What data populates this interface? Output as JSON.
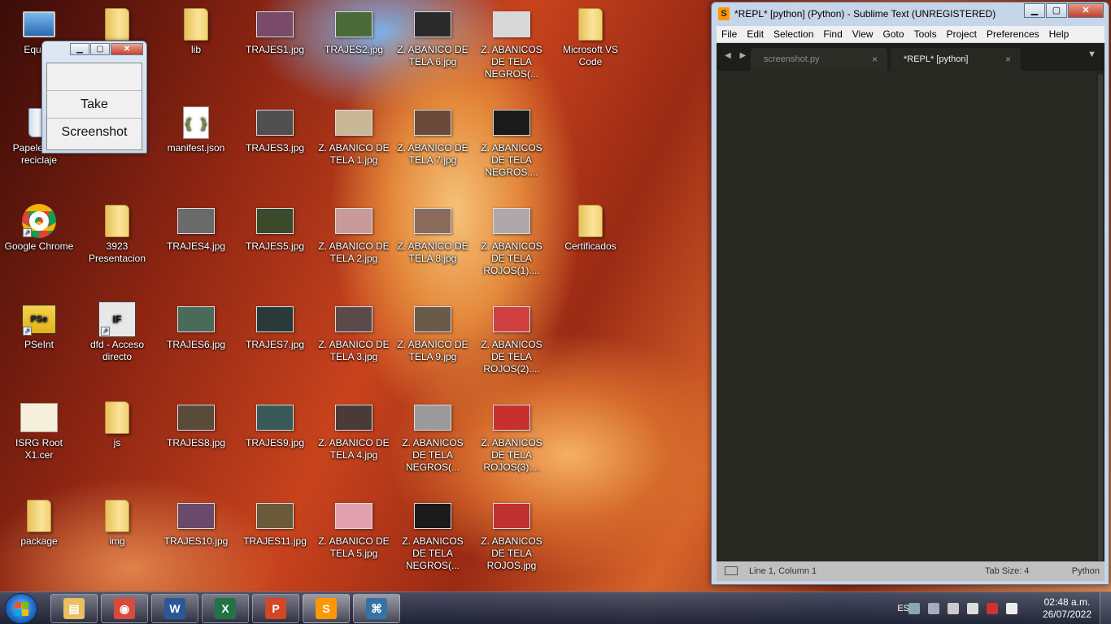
{
  "desktop_icons": [
    {
      "label": "Equipo",
      "kind": "computer"
    },
    {
      "label": "",
      "kind": "folder"
    },
    {
      "label": "lib",
      "kind": "folder"
    },
    {
      "label": "TRAJES1.jpg",
      "kind": "thumb",
      "color": "#7a4a6a"
    },
    {
      "label": "TRAJES2.jpg",
      "kind": "thumb",
      "color": "#4a6a3a"
    },
    {
      "label": "Z. ABANICO DE TELA 6.jpg",
      "kind": "thumb",
      "color": "#2a2a2a"
    },
    {
      "label": "Z. ABANICOS DE TELA NEGROS(...",
      "kind": "thumb",
      "color": "#d8d8d8"
    },
    {
      "label": "Microsoft VS Code",
      "kind": "folder"
    },
    {
      "label": "Papelera de reciclaje",
      "kind": "recycle"
    },
    {
      "label": "manifest.json",
      "kind": "json"
    },
    {
      "label": "TRAJES3.jpg",
      "kind": "thumb",
      "color": "#505050"
    },
    {
      "label": "Z. ABANICO DE TELA 1.jpg",
      "kind": "thumb",
      "color": "#c8b898"
    },
    {
      "label": "Z. ABANICO DE TELA 7.jpg",
      "kind": "thumb",
      "color": "#6a4a3a"
    },
    {
      "label": "Z. ABANICOS DE TELA NEGROS....",
      "kind": "thumb",
      "color": "#1a1a1a"
    },
    {
      "label": "Google Chrome",
      "kind": "chrome"
    },
    {
      "label": "3923 Presentacion",
      "kind": "folder"
    },
    {
      "label": "TRAJES4.jpg",
      "kind": "thumb",
      "color": "#6a6a6a"
    },
    {
      "label": "TRAJES5.jpg",
      "kind": "thumb",
      "color": "#3a4a2a"
    },
    {
      "label": "Z. ABANICO DE TELA 2.jpg",
      "kind": "thumb",
      "color": "#c89a9a"
    },
    {
      "label": "Z. ABANICO DE TELA 8.jpg",
      "kind": "thumb",
      "color": "#8a6a5a"
    },
    {
      "label": "Z. ABANICOS DE TELA ROJOS(1)....",
      "kind": "thumb",
      "color": "#b0a8a8"
    },
    {
      "label": "Certificados",
      "kind": "folder"
    },
    {
      "label": "PSeInt",
      "kind": "pseint"
    },
    {
      "label": "dfd - Acceso directo",
      "kind": "dfd"
    },
    {
      "label": "TRAJES6.jpg",
      "kind": "thumb",
      "color": "#4a6a5a"
    },
    {
      "label": "TRAJES7.jpg",
      "kind": "thumb",
      "color": "#2a3a3a"
    },
    {
      "label": "Z. ABANICO DE TELA 3.jpg",
      "kind": "thumb",
      "color": "#5a4a4a"
    },
    {
      "label": "Z. ABANICO DE TELA 9.jpg",
      "kind": "thumb",
      "color": "#6a5a4a"
    },
    {
      "label": "Z. ABANICOS DE TELA ROJOS(2)....",
      "kind": "thumb",
      "color": "#d04040"
    },
    {
      "label": "ISRG Root X1.cer",
      "kind": "cert"
    },
    {
      "label": "js",
      "kind": "folder"
    },
    {
      "label": "TRAJES8.jpg",
      "kind": "thumb",
      "color": "#5a4a3a"
    },
    {
      "label": "TRAJES9.jpg",
      "kind": "thumb",
      "color": "#3a5a5a"
    },
    {
      "label": "Z. ABANICO DE TELA 4.jpg",
      "kind": "thumb",
      "color": "#4a3a3a"
    },
    {
      "label": "Z. ABANICOS DE TELA NEGROS(...",
      "kind": "thumb",
      "color": "#9a9a9a"
    },
    {
      "label": "Z. ABANICOS DE TELA ROJOS(3)....",
      "kind": "thumb",
      "color": "#c83030"
    },
    {
      "label": "package",
      "kind": "folder"
    },
    {
      "label": "img",
      "kind": "folder"
    },
    {
      "label": "TRAJES10.jpg",
      "kind": "thumb",
      "color": "#6a4a6a"
    },
    {
      "label": "TRAJES11.jpg",
      "kind": "thumb",
      "color": "#6a5a3a"
    },
    {
      "label": "Z. ABANICO DE TELA 5.jpg",
      "kind": "thumb",
      "color": "#e0a0b0"
    },
    {
      "label": "Z. ABANICOS DE TELA NEGROS(...",
      "kind": "thumb",
      "color": "#1a1a1a"
    },
    {
      "label": "Z. ABANICOS DE TELA ROJOS.jpg",
      "kind": "thumb",
      "color": "#c03030"
    }
  ],
  "tk_window": {
    "button_label": "Take Screenshot",
    "minimize": "▁",
    "maximize": "▢",
    "close": "✕"
  },
  "sublime": {
    "title": "*REPL* [python] (Python) - Sublime Text (UNREGISTERED)",
    "logo_letter": "S",
    "minimize": "▁",
    "maximize": "▢",
    "close": "✕",
    "menu": [
      "File",
      "Edit",
      "Selection",
      "Find",
      "View",
      "Goto",
      "Tools",
      "Project",
      "Preferences",
      "Help"
    ],
    "tab_arrows": "◀ ▶",
    "tabs": [
      {
        "label": "screenshot.py",
        "active": false,
        "close": "×"
      },
      {
        "label": "*REPL* [python]",
        "active": true,
        "close": "×"
      }
    ],
    "tab_menu": "▼",
    "status": {
      "position": "Line 1, Column 1",
      "tab_size": "Tab Size: 4",
      "syntax": "Python"
    }
  },
  "taskbar": {
    "pinned": [
      {
        "name": "explorer",
        "glyph": "▤",
        "color": "#e8c060"
      },
      {
        "name": "chrome",
        "glyph": "◉",
        "color": "#d94a3a"
      },
      {
        "name": "word",
        "glyph": "W",
        "color": "#2b579a"
      },
      {
        "name": "excel",
        "glyph": "X",
        "color": "#217346"
      },
      {
        "name": "powerpoint",
        "glyph": "P",
        "color": "#d24726"
      },
      {
        "name": "sublime",
        "glyph": "S",
        "color": "#ff9800"
      },
      {
        "name": "python",
        "glyph": "⌘",
        "color": "#3572a5"
      }
    ],
    "language": "ES",
    "time": "02:48 a.m.",
    "date": "26/07/2022"
  }
}
